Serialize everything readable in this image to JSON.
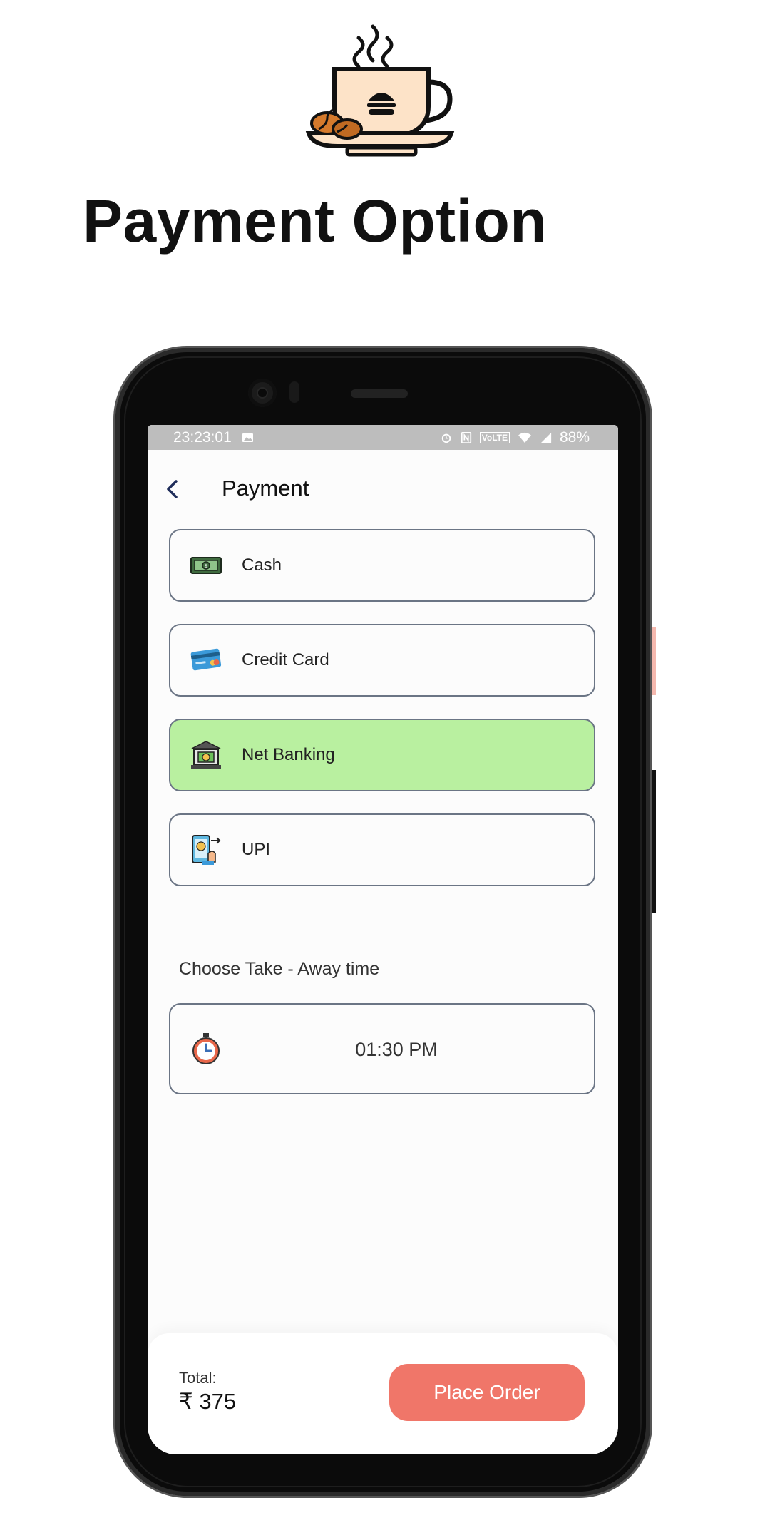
{
  "banner": {
    "headline": "Payment Option",
    "logo_icon": "coffee-cup-burger-icon"
  },
  "statusbar": {
    "time": "23:23:01",
    "battery": "88%",
    "volte": "VoLTE"
  },
  "appbar": {
    "title": "Payment"
  },
  "payment_options": [
    {
      "label": "Cash",
      "icon": "cash-icon",
      "selected": false
    },
    {
      "label": "Credit Card",
      "icon": "credit-card-icon",
      "selected": false
    },
    {
      "label": "Net Banking",
      "icon": "bank-icon",
      "selected": true
    },
    {
      "label": "UPI",
      "icon": "upi-phone-icon",
      "selected": false
    }
  ],
  "takeaway": {
    "label": "Choose Take - Away time",
    "time": "01:30 PM"
  },
  "footer": {
    "total_label": "Total:",
    "total_value": "₹ 375",
    "place_order": "Place Order"
  },
  "colors": {
    "selected_option": "#b9f0a0",
    "accent_button": "#f07669",
    "border": "#6b7585"
  }
}
